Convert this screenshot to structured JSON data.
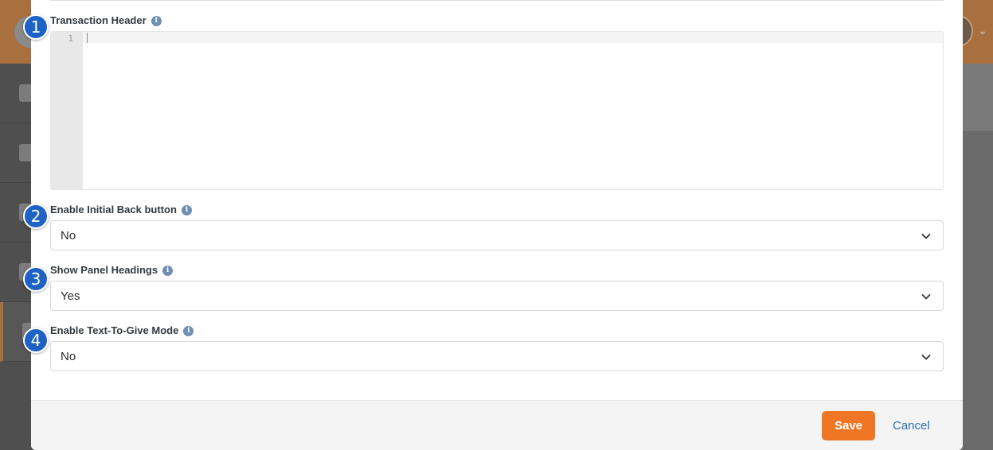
{
  "form": {
    "transaction_header": {
      "label": "Transaction Header",
      "line_number": "1",
      "value": ""
    },
    "enable_initial_back_button": {
      "label": "Enable Initial Back button",
      "value": "No"
    },
    "show_panel_headings": {
      "label": "Show Panel Headings",
      "value": "Yes"
    },
    "enable_text_to_give_mode": {
      "label": "Enable Text-To-Give Mode",
      "value": "No"
    }
  },
  "footer": {
    "save_label": "Save",
    "cancel_label": "Cancel"
  },
  "callouts": [
    "1",
    "2",
    "3",
    "4"
  ],
  "icons": {
    "info": "info-icon",
    "dropdown": "chevron-down-icon"
  },
  "colors": {
    "accent": "#ee7625",
    "link": "#2f6fb0",
    "callout": "#1d62c4"
  }
}
